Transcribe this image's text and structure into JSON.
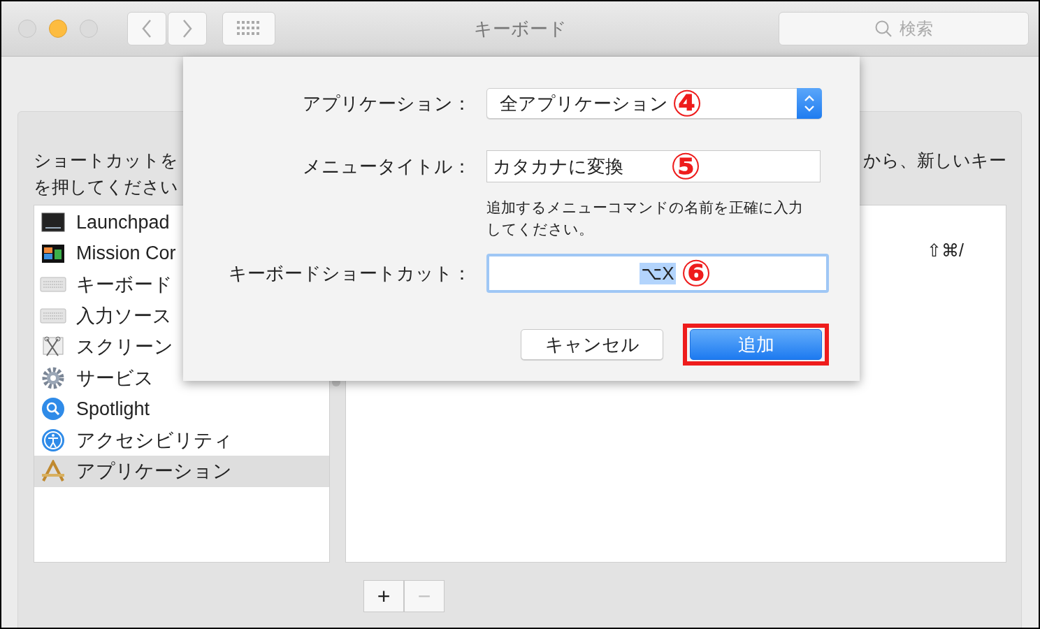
{
  "window": {
    "title": "キーボード",
    "search_placeholder": "検索"
  },
  "instructions": {
    "left_lines": [
      "ショートカットを",
      "を押してください"
    ],
    "right_line": "から、新しいキー"
  },
  "categories": [
    {
      "label": "Launchpad",
      "kind": "launchpad",
      "selected": false
    },
    {
      "label": "Mission Cor",
      "kind": "mission",
      "selected": false
    },
    {
      "label": "キーボード",
      "kind": "keyboard",
      "selected": false
    },
    {
      "label": "入力ソース",
      "kind": "keyboard",
      "selected": false
    },
    {
      "label": "スクリーン",
      "kind": "screenshot",
      "selected": false
    },
    {
      "label": "サービス",
      "kind": "gear",
      "selected": false
    },
    {
      "label": "Spotlight",
      "kind": "spotlight",
      "selected": false
    },
    {
      "label": "アクセシビリティ",
      "kind": "accessibility",
      "selected": false
    },
    {
      "label": "アプリケーション",
      "kind": "app",
      "selected": true
    }
  ],
  "shortcuts": [
    {
      "keys": "⇧⌘/"
    }
  ],
  "list_buttons": [
    {
      "label": "+",
      "disabled": false
    },
    {
      "label": "−",
      "disabled": true
    }
  ],
  "sheet": {
    "rows": [
      {
        "kind": "popup",
        "label": "アプリケーション：",
        "value": "全アプリケーション",
        "annotation": "④"
      },
      {
        "kind": "text",
        "label": "メニュータイトル：",
        "value": "カタカナに変換",
        "annotation": "⑤",
        "help": "追加するメニューコマンドの名前を正確に入力してください。"
      },
      {
        "kind": "shortcut",
        "label": "キーボードショートカット：",
        "value": "⌥X",
        "focused": true,
        "annotation": "⑥"
      }
    ],
    "buttons": [
      {
        "label": "キャンセル",
        "kind": "default",
        "highlighted": false
      },
      {
        "label": "追加",
        "kind": "primary",
        "highlighted": true
      }
    ]
  }
}
